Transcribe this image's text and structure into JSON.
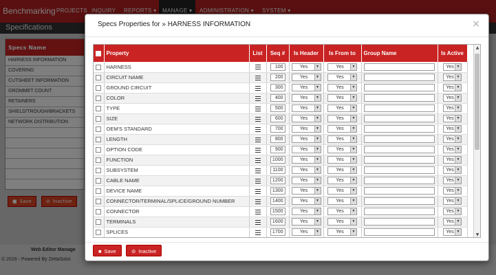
{
  "navbar": {
    "brand": "Benchmarking",
    "items": [
      "PROJECTS",
      "INQUIRY",
      "REPORTS ▾",
      "MANAGE ▾",
      "ADMINISTRATION ▾",
      "SYSTEM ▾"
    ]
  },
  "specbar": {
    "title": "Specifications"
  },
  "background_panel": {
    "header": "Specs Name",
    "rows": [
      "HARNESS INFORMATION",
      "COVERING",
      "CUTSHEET INFORMATION",
      "GROMMET COUNT",
      "RETAINERS",
      "SHIELD/TROUGH/BRACKETS",
      "NETWORK DISTRIBUTION"
    ],
    "save_label": "Save",
    "inactive_label": "Inactive"
  },
  "footer": {
    "title": "Web Editor Manage",
    "copyright": "© 2016 - Powered By ZettaSolut"
  },
  "modal": {
    "title": "Specs Properties for » HARNESS INFORMATION",
    "close": "×",
    "columns": [
      "Property",
      "List",
      "Seq #",
      "Is Header",
      "Is From to",
      "Group Name",
      "Is Active"
    ],
    "rows": [
      {
        "property": "HARNESS",
        "seq": "100",
        "is_header": "Yes",
        "is_from_to": "Yes",
        "is_active": "Yes"
      },
      {
        "property": "CIRCUIT NAME",
        "seq": "200",
        "is_header": "Yes",
        "is_from_to": "Yes",
        "is_active": "Yes"
      },
      {
        "property": "GROUND CIRCUIT",
        "seq": "300",
        "is_header": "Yes",
        "is_from_to": "Yes",
        "is_active": "Yes"
      },
      {
        "property": "COLOR",
        "seq": "400",
        "is_header": "Yes",
        "is_from_to": "Yes",
        "is_active": "Yes"
      },
      {
        "property": "TYPE",
        "seq": "500",
        "is_header": "Yes",
        "is_from_to": "Yes",
        "is_active": "Yes"
      },
      {
        "property": "SIZE",
        "seq": "600",
        "is_header": "Yes",
        "is_from_to": "Yes",
        "is_active": "Yes"
      },
      {
        "property": "OEM'S STANDARD",
        "seq": "700",
        "is_header": "Yes",
        "is_from_to": "Yes",
        "is_active": "Yes"
      },
      {
        "property": "LENGTH",
        "seq": "800",
        "is_header": "Yes",
        "is_from_to": "Yes",
        "is_active": "Yes"
      },
      {
        "property": "OPTION CODE",
        "seq": "900",
        "is_header": "Yes",
        "is_from_to": "Yes",
        "is_active": "Yes"
      },
      {
        "property": "FUNCTION",
        "seq": "1000",
        "is_header": "Yes",
        "is_from_to": "Yes",
        "is_active": "Yes"
      },
      {
        "property": "SUBSYSTEM",
        "seq": "1100",
        "is_header": "Yes",
        "is_from_to": "Yes",
        "is_active": "Yes"
      },
      {
        "property": "CABLE NAME",
        "seq": "1200",
        "is_header": "Yes",
        "is_from_to": "Yes",
        "is_active": "Yes"
      },
      {
        "property": "DEVICE NAME",
        "seq": "1300",
        "is_header": "Yes",
        "is_from_to": "Yes",
        "is_active": "Yes"
      },
      {
        "property": "CONNECTOR/TERMINAL/SPLICE/GROUND NUMBER",
        "seq": "1400",
        "is_header": "Yes",
        "is_from_to": "Yes",
        "is_active": "Yes"
      },
      {
        "property": "CONNECTOR",
        "seq": "1500",
        "is_header": "Yes",
        "is_from_to": "Yes",
        "is_active": "Yes"
      },
      {
        "property": "TERMINALS",
        "seq": "1600",
        "is_header": "Yes",
        "is_from_to": "Yes",
        "is_active": "Yes"
      },
      {
        "property": "SPLICES",
        "seq": "1700",
        "is_header": "Yes",
        "is_from_to": "Yes",
        "is_active": "Yes"
      }
    ],
    "save_label": "Save",
    "inactive_label": "Inactive"
  },
  "colors": {
    "primary": "#c92323",
    "navbar": "#b52020",
    "overlay": "rgba(0,0,0,0.5)"
  },
  "icons": [
    "list-icon",
    "save-icon",
    "ban-icon",
    "close-icon",
    "checkbox-icon",
    "caret-down-icon"
  ]
}
